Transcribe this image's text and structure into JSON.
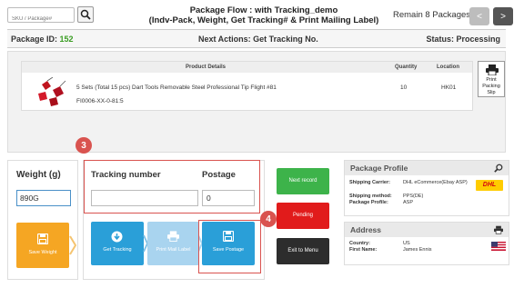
{
  "search": {
    "placeholder": "SKU / Package#"
  },
  "flow": {
    "title": "Package Flow : with Tracking_demo",
    "subtitle": "(Indv-Pack, Weight, Get Tracking# & Print Mailing Label)",
    "remain": "Remain 8 Packages",
    "prev_icon": "<",
    "next_icon": ">"
  },
  "info": {
    "package_id_label": "Package ID:",
    "package_id": "152",
    "next_actions": "Next Actions: Get Tracking No.",
    "status": "Status: Processing"
  },
  "product_table": {
    "headers": [
      "Product Details",
      "Quantity",
      "Location"
    ],
    "rows": [
      {
        "name": "5 Sets (Total 15 pcs) Dart Tools Removable Steel Professional Tip Flight #81",
        "sku": "FI0006-XX-0-81:5",
        "quantity": "10",
        "location": "HK01"
      }
    ],
    "print_slip_label": "Print Packing Slip"
  },
  "weight": {
    "label": "Weight (g)",
    "value": "890G",
    "save_label": "Save Weight"
  },
  "tracking": {
    "tracking_label": "Tracking number",
    "tracking_value": "",
    "postage_label": "Postage",
    "postage_value": "0",
    "get_tracking_label": "Get Tracking",
    "print_mail_label": "Print Mail Label",
    "save_postage_label": "Save Postage",
    "badge3": "3",
    "badge4": "4"
  },
  "actions": {
    "next_record": "Next record",
    "pending": "Pending",
    "exit": "Exit to Menu"
  },
  "profile": {
    "title": "Package Profile",
    "carrier_label": "Shipping Carrier:",
    "carrier_value": "DHL eCommerce(Ebay ASP)",
    "method_label": "Shipping method:",
    "method_value": "PPS(DE)",
    "profile_label": "Package Profile:",
    "profile_value": "ASP",
    "logo_text": "DHL"
  },
  "address": {
    "title": "Address",
    "country_label": "Country:",
    "country_value": "US",
    "first_name_label": "First Name:",
    "first_name_value": "James Ennis"
  },
  "colors": {
    "accent_blue": "#2a9fd8",
    "orange": "#f5a623",
    "green": "#3db34a",
    "red": "#e11b1b",
    "highlight": "#d9534f"
  }
}
